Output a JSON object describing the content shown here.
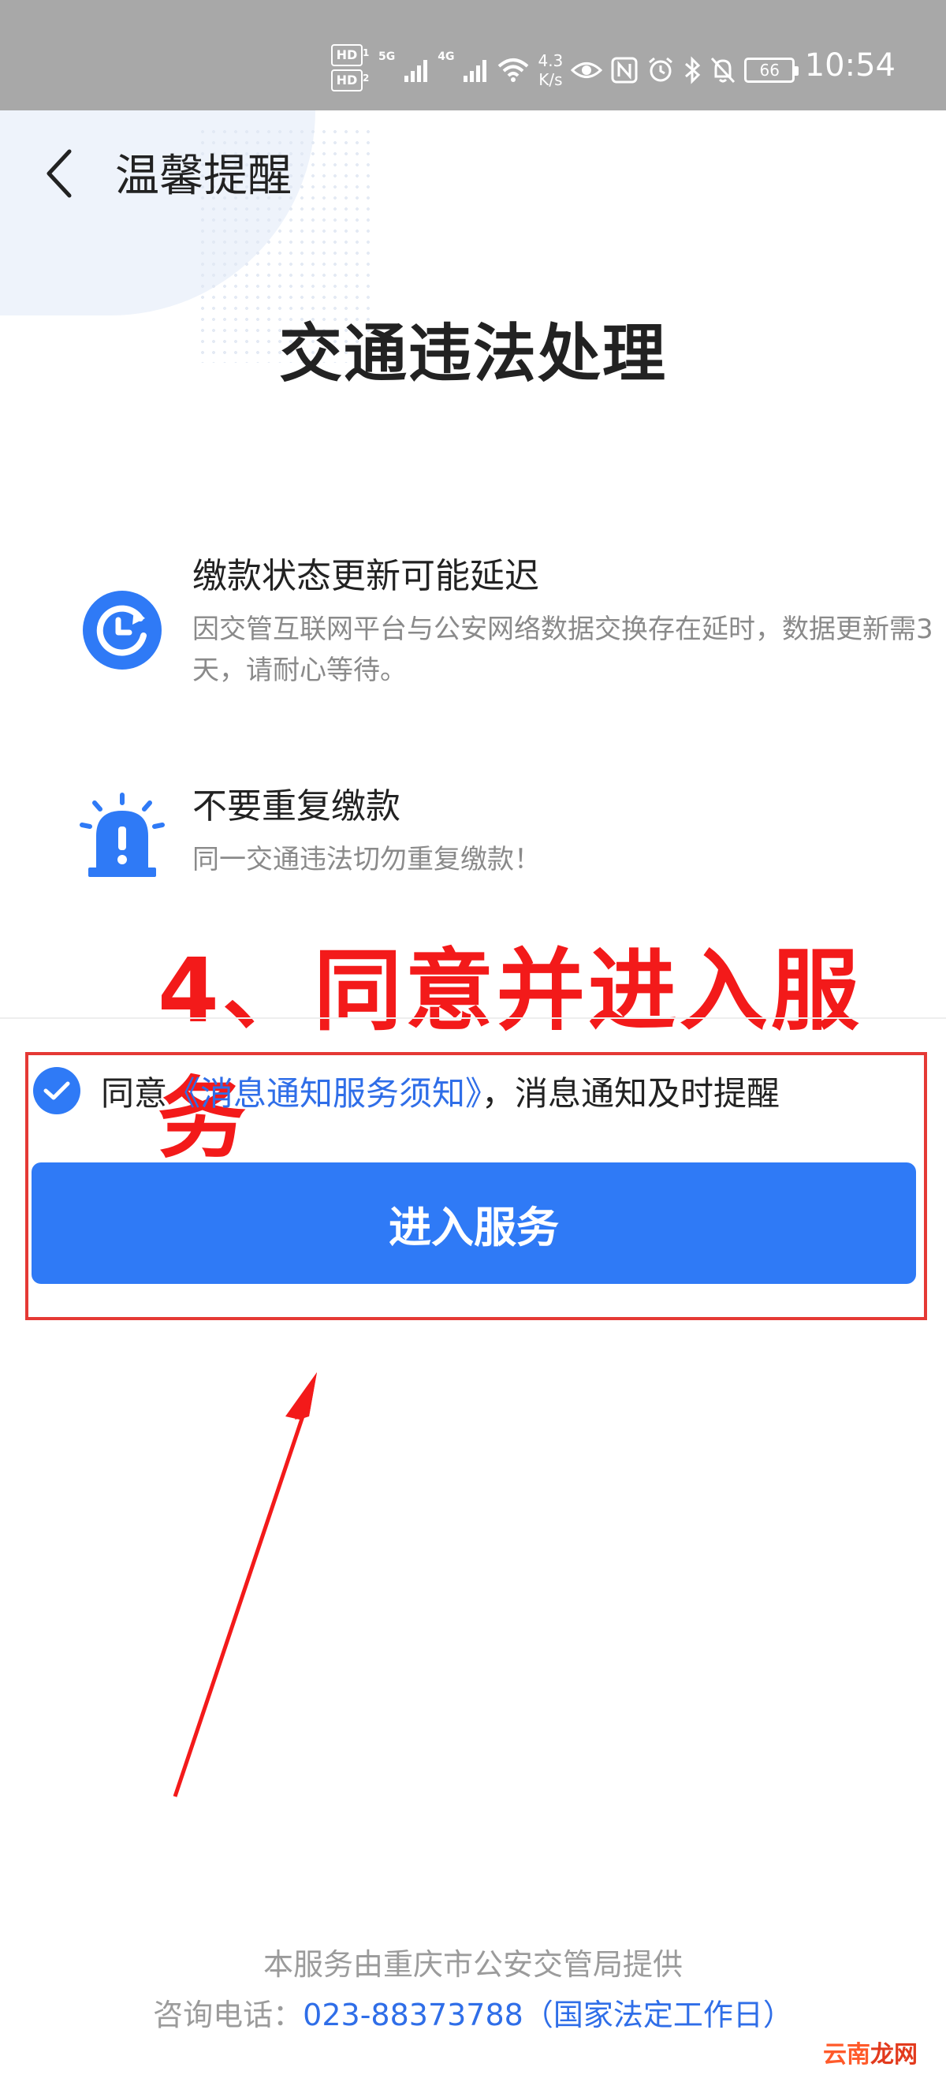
{
  "status_bar": {
    "hd1": "HD",
    "hd1_sub": "1",
    "hd2": "HD",
    "hd2_sub": "2",
    "net1": "5G",
    "net2": "4G",
    "speed_value": "4.3",
    "speed_unit": "K/s",
    "battery": "66",
    "time": "10:54"
  },
  "nav": {
    "title": "温馨提醒"
  },
  "main": {
    "heading": "交通违法处理",
    "tips": [
      {
        "title": "缴款状态更新可能延迟",
        "desc": "因交管互联网平台与公安网络数据交换存在延时，数据更新需3天，请耐心等待。"
      },
      {
        "title": "不要重复缴款",
        "desc": "同一交通违法切勿重复缴款！"
      }
    ]
  },
  "annotation": {
    "text": "4、同意并进入服务"
  },
  "agreement": {
    "prefix": "同意",
    "link": "《消息通知服务须知》",
    "suffix": "，消息通知及时提醒",
    "checked": true
  },
  "enter_button": {
    "label": "进入服务"
  },
  "footer": {
    "line1": "本服务由重庆市公安交管局提供",
    "line2_prefix": "咨询电话：",
    "phone": "023-88373788（国家法定工作日）"
  },
  "watermark": {
    "part1": "云南",
    "part2": "龙网"
  },
  "colors": {
    "accent": "#2f7af6",
    "annotation": "#f31a1a",
    "status_bar": "#a8a8a8"
  }
}
